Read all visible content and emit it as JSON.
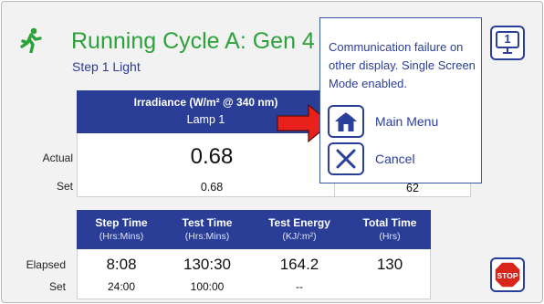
{
  "header": {
    "title": "Running Cycle A: Gen 4",
    "step": "Step 1 Light"
  },
  "irradiance": {
    "header_line1": "Irradiance (W/m² @ 340 nm)",
    "header_line2": "Lamp 1",
    "actual_label": "Actual",
    "set_label": "Set",
    "actual_value": "0.68",
    "set_value": "0.68"
  },
  "right_panel": {
    "set_value": "62"
  },
  "times": {
    "columns": [
      {
        "title": "Step Time",
        "unit": "(Hrs:Mins)",
        "elapsed": "8:08",
        "set": "24:00"
      },
      {
        "title": "Test Time",
        "unit": "(Hrs:Mins)",
        "elapsed": "130:30",
        "set": "100:00"
      },
      {
        "title": "Test Energy",
        "unit": "(KJ/:m²)",
        "elapsed": "164.2",
        "set": "--"
      },
      {
        "title": "Total Time",
        "unit": "(Hrs)",
        "elapsed": "130",
        "set": ""
      }
    ],
    "elapsed_label": "Elapsed",
    "set_label": "Set"
  },
  "popup": {
    "message": "Communication failure on other display.  Single Screen Mode enabled.",
    "main_menu_label": "Main Menu",
    "cancel_label": "Cancel"
  },
  "screen_button": {
    "number": "1"
  },
  "stop_button": {
    "label": "STOP"
  },
  "colors": {
    "title": "#2ca23a",
    "header_bg": "#2a3e97",
    "accent": "#2a3f9a",
    "arrow": "#e8211c",
    "stop": "#d9261c"
  },
  "icons": {
    "runner": "running-person-icon",
    "home": "home-icon",
    "cancel": "close-icon",
    "screen": "single-screen-icon",
    "stop": "stop-sign-icon"
  }
}
